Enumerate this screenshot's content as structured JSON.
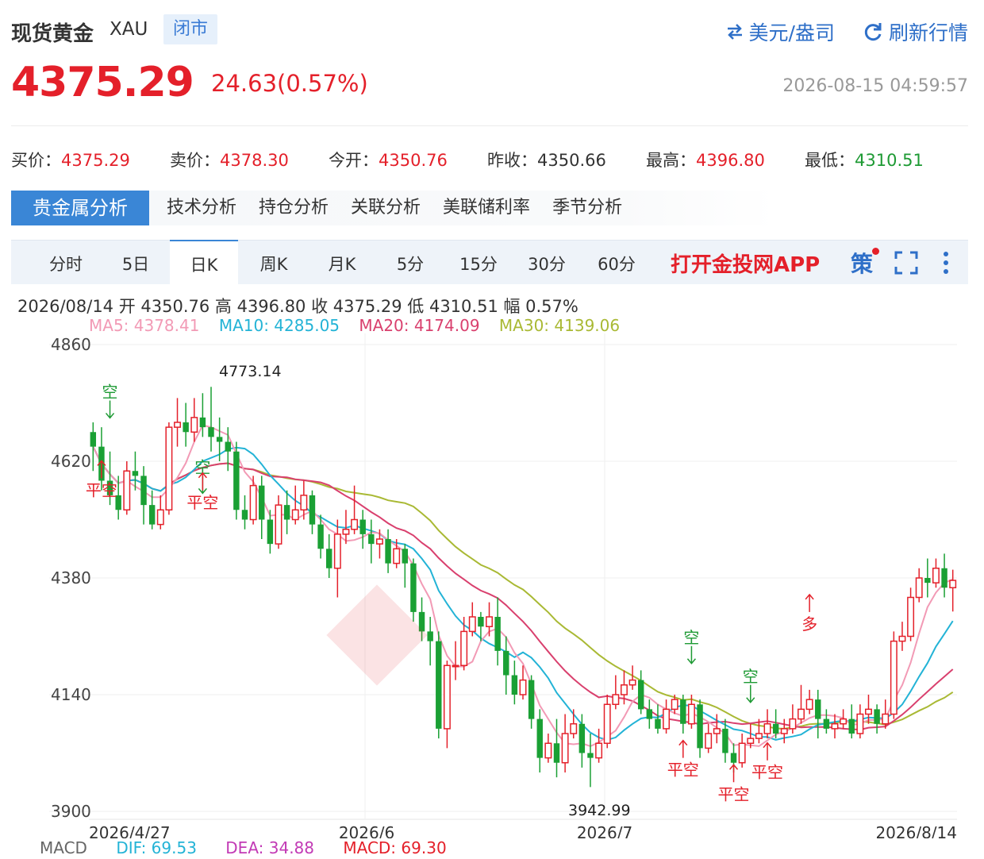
{
  "header": {
    "title": "现货黄金",
    "symbol": "XAU",
    "status": "闭市",
    "currency_toggle": "美元/盎司",
    "refresh": "刷新行情"
  },
  "price": {
    "last": "4375.29",
    "change": "24.63(0.57%)",
    "timestamp": "2026-08-15 04:59:57"
  },
  "quotes": [
    {
      "label": "买价：",
      "value": "4375.29",
      "tone": "red"
    },
    {
      "label": "卖价：",
      "value": "4378.30",
      "tone": "red"
    },
    {
      "label": "今开：",
      "value": "4350.76",
      "tone": "red"
    },
    {
      "label": "昨收：",
      "value": "4350.66",
      "tone": "gray"
    },
    {
      "label": "最高：",
      "value": "4396.80",
      "tone": "red"
    },
    {
      "label": "最低：",
      "value": "4310.51",
      "tone": "green"
    }
  ],
  "tabs": [
    "贵金属分析",
    "技术分析",
    "持仓分析",
    "关联分析",
    "美联储利率",
    "季节分析"
  ],
  "periods": [
    "分时",
    "5日",
    "日K",
    "周K",
    "月K",
    "5分",
    "15分",
    "30分",
    "60分"
  ],
  "active_period": "日K",
  "toolbar": {
    "app_link": "打开金投网APP",
    "strategy": "策"
  },
  "ohlc_summary": "2026/08/14  开 4350.76  高 4396.80  收 4375.29  低 4310.51  幅 0.57%",
  "ma": [
    {
      "label": "MA5: 4378.41",
      "color": "#f29ab5"
    },
    {
      "label": "MA10: 4285.05",
      "color": "#23b3d6"
    },
    {
      "label": "MA20: 4174.09",
      "color": "#d9406e"
    },
    {
      "label": "MA30: 4139.06",
      "color": "#a9b934"
    }
  ],
  "macd": {
    "label": "MACD",
    "dif": "DIF: 69.53",
    "dea": "DEA: 34.88",
    "macd": "MACD: 69.30"
  },
  "chart_data": {
    "type": "candlestick",
    "y_ticks": [
      "4860",
      "4620",
      "4380",
      "4140",
      "3900"
    ],
    "x_ticks": [
      "2026/4/27",
      "2026/6",
      "2026/7",
      "2026/8/14"
    ],
    "ylim": [
      3900,
      4860
    ],
    "annotations": {
      "high": "4773.14",
      "low": "3942.99",
      "signals": [
        {
          "text": "空",
          "x": 2,
          "price": 4745,
          "dir": "down",
          "color": "#1e9a34"
        },
        {
          "text": "平空",
          "x": 1,
          "price": 4585,
          "dir": "up",
          "color": "#e4202a"
        },
        {
          "text": "空",
          "x": 13,
          "price": 4590,
          "dir": "down",
          "color": "#1e9a34"
        },
        {
          "text": "平空",
          "x": 13,
          "price": 4560,
          "dir": "up",
          "color": "#e4202a"
        },
        {
          "text": "空",
          "x": 71,
          "price": 4240,
          "dir": "down",
          "color": "#1e9a34"
        },
        {
          "text": "平空",
          "x": 70,
          "price": 4010,
          "dir": "up",
          "color": "#e4202a"
        },
        {
          "text": "空",
          "x": 78,
          "price": 4160,
          "dir": "down",
          "color": "#1e9a34"
        },
        {
          "text": "平空",
          "x": 76,
          "price": 3960,
          "dir": "up",
          "color": "#e4202a"
        },
        {
          "text": "平空",
          "x": 80,
          "price": 4005,
          "dir": "up",
          "color": "#e4202a"
        },
        {
          "text": "多",
          "x": 85,
          "price": 4310,
          "dir": "up",
          "color": "#e4202a"
        }
      ]
    },
    "candles": [
      [
        4680,
        4650,
        4700,
        4600
      ],
      [
        4650,
        4580,
        4690,
        4560
      ],
      [
        4580,
        4550,
        4640,
        4530
      ],
      [
        4550,
        4520,
        4590,
        4500
      ],
      [
        4520,
        4600,
        4620,
        4510
      ],
      [
        4600,
        4590,
        4640,
        4560
      ],
      [
        4590,
        4530,
        4610,
        4490
      ],
      [
        4530,
        4490,
        4560,
        4480
      ],
      [
        4490,
        4520,
        4550,
        4480
      ],
      [
        4520,
        4690,
        4700,
        4510
      ],
      [
        4690,
        4700,
        4750,
        4650
      ],
      [
        4700,
        4680,
        4740,
        4650
      ],
      [
        4680,
        4710,
        4750,
        4660
      ],
      [
        4710,
        4690,
        4760,
        4670
      ],
      [
        4690,
        4670,
        4773,
        4640
      ],
      [
        4670,
        4660,
        4710,
        4620
      ],
      [
        4660,
        4640,
        4690,
        4600
      ],
      [
        4640,
        4520,
        4660,
        4500
      ],
      [
        4520,
        4500,
        4550,
        4480
      ],
      [
        4500,
        4570,
        4590,
        4490
      ],
      [
        4570,
        4500,
        4590,
        4460
      ],
      [
        4500,
        4450,
        4520,
        4430
      ],
      [
        4450,
        4530,
        4550,
        4440
      ],
      [
        4530,
        4500,
        4560,
        4470
      ],
      [
        4500,
        4520,
        4570,
        4490
      ],
      [
        4520,
        4550,
        4580,
        4500
      ],
      [
        4550,
        4490,
        4560,
        4470
      ],
      [
        4490,
        4440,
        4510,
        4420
      ],
      [
        4440,
        4400,
        4470,
        4380
      ],
      [
        4400,
        4470,
        4500,
        4340
      ],
      [
        4470,
        4480,
        4520,
        4450
      ],
      [
        4480,
        4500,
        4570,
        4470
      ],
      [
        4500,
        4470,
        4520,
        4440
      ],
      [
        4470,
        4450,
        4500,
        4410
      ],
      [
        4450,
        4460,
        4480,
        4420
      ],
      [
        4460,
        4410,
        4480,
        4390
      ],
      [
        4410,
        4440,
        4460,
        4400
      ],
      [
        4440,
        4410,
        4450,
        4360
      ],
      [
        4410,
        4310,
        4420,
        4290
      ],
      [
        4310,
        4270,
        4340,
        4250
      ],
      [
        4270,
        4250,
        4300,
        4200
      ],
      [
        4250,
        4070,
        4270,
        4050
      ],
      [
        4070,
        4200,
        4210,
        4030
      ],
      [
        4200,
        4200,
        4250,
        4170
      ],
      [
        4200,
        4270,
        4300,
        4190
      ],
      [
        4270,
        4300,
        4330,
        4260
      ],
      [
        4300,
        4280,
        4310,
        4250
      ],
      [
        4280,
        4300,
        4330,
        4260
      ],
      [
        4300,
        4230,
        4340,
        4200
      ],
      [
        4230,
        4180,
        4260,
        4140
      ],
      [
        4180,
        4140,
        4210,
        4120
      ],
      [
        4140,
        4170,
        4200,
        4130
      ],
      [
        4170,
        4090,
        4180,
        4070
      ],
      [
        4090,
        4010,
        4110,
        3980
      ],
      [
        4010,
        4040,
        4060,
        4000
      ],
      [
        4040,
        4000,
        4090,
        3970
      ],
      [
        4000,
        4060,
        4100,
        3980
      ],
      [
        4060,
        4080,
        4110,
        4050
      ],
      [
        4080,
        4020,
        4100,
        3990
      ],
      [
        4020,
        4010,
        4060,
        3950
      ],
      [
        4010,
        4040,
        4070,
        4000
      ],
      [
        4040,
        4120,
        4140,
        4030
      ],
      [
        4120,
        4140,
        4180,
        4110
      ],
      [
        4140,
        4160,
        4190,
        4120
      ],
      [
        4160,
        4170,
        4200,
        4150
      ],
      [
        4170,
        4110,
        4190,
        4100
      ],
      [
        4110,
        4090,
        4130,
        4070
      ],
      [
        4090,
        4070,
        4120,
        4060
      ],
      [
        4070,
        4110,
        4130,
        4060
      ],
      [
        4110,
        4130,
        4140,
        4100
      ],
      [
        4130,
        4080,
        4140,
        4060
      ],
      [
        4080,
        4120,
        4140,
        4070
      ],
      [
        4120,
        4030,
        4130,
        4010
      ],
      [
        4030,
        4060,
        4080,
        4020
      ],
      [
        4060,
        4070,
        4100,
        4040
      ],
      [
        4070,
        4020,
        4090,
        4000
      ],
      [
        4020,
        4000,
        4040,
        3980
      ],
      [
        4000,
        4040,
        4060,
        3990
      ],
      [
        4040,
        4050,
        4080,
        4030
      ],
      [
        4050,
        4060,
        4090,
        4040
      ],
      [
        4060,
        4080,
        4110,
        4050
      ],
      [
        4080,
        4060,
        4110,
        4050
      ],
      [
        4060,
        4070,
        4090,
        4040
      ],
      [
        4070,
        4090,
        4120,
        4060
      ],
      [
        4090,
        4110,
        4160,
        4080
      ],
      [
        4110,
        4130,
        4150,
        4100
      ],
      [
        4130,
        4090,
        4150,
        4050
      ],
      [
        4090,
        4070,
        4110,
        4060
      ],
      [
        4070,
        4080,
        4100,
        4050
      ],
      [
        4080,
        4090,
        4110,
        4070
      ],
      [
        4090,
        4060,
        4120,
        4050
      ],
      [
        4060,
        4100,
        4120,
        4050
      ],
      [
        4100,
        4110,
        4140,
        4080
      ],
      [
        4110,
        4080,
        4120,
        4060
      ],
      [
        4080,
        4100,
        4130,
        4070
      ],
      [
        4100,
        4250,
        4270,
        4090
      ],
      [
        4250,
        4260,
        4290,
        4230
      ],
      [
        4260,
        4340,
        4360,
        4250
      ],
      [
        4340,
        4380,
        4400,
        4330
      ],
      [
        4380,
        4370,
        4420,
        4340
      ],
      [
        4370,
        4400,
        4420,
        4360
      ],
      [
        4400,
        4360,
        4430,
        4340
      ],
      [
        4360,
        4375,
        4397,
        4311
      ]
    ]
  }
}
